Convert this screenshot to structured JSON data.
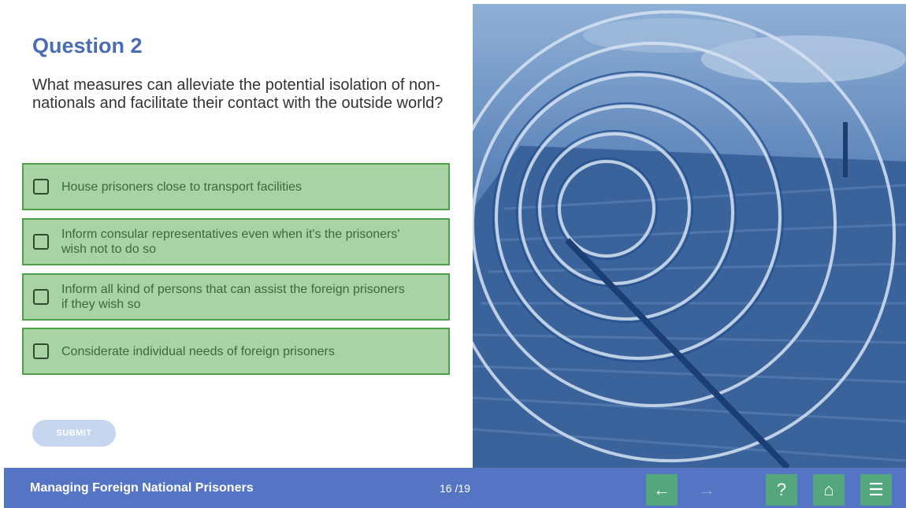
{
  "question": {
    "title": "Question 2",
    "text": "What measures can alleviate the potential isolation of non-nationals and facilitate their contact with the outside world?"
  },
  "options": [
    {
      "label": "House prisoners close to transport facilities",
      "checked": false
    },
    {
      "label": "Inform consular representatives even when it's the prisoners' wish not to do so",
      "checked": false
    },
    {
      "label": "Inform all kind of persons that can assist the foreign prisoners if they wish so",
      "checked": false
    },
    {
      "label": "Considerate individual needs of foreign prisoners",
      "checked": false
    }
  ],
  "submit_label": "SUBMIT",
  "footer": {
    "course_title": "Managing Foreign National Prisoners",
    "page_indicator": "16 /19",
    "prev_icon": "←",
    "next_icon": "→",
    "help_icon": "?",
    "home_icon": "⌂",
    "menu_icon": "☰"
  },
  "colors": {
    "accent_blue": "#4a6bb6",
    "footer_blue": "#5574c4",
    "option_fill": "#a9d3a5",
    "option_border": "#4ea14a",
    "nav_green": "#54a67e",
    "submit_disabled": "#c6d6ee"
  }
}
